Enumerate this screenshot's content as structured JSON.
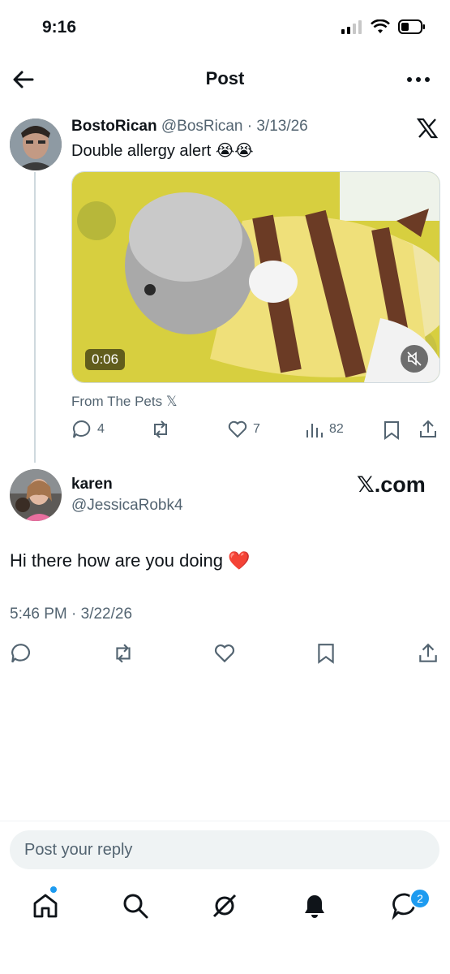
{
  "status": {
    "time": "9:16"
  },
  "header": {
    "title": "Post"
  },
  "quoted_post": {
    "display_name": "BostoRican",
    "handle": "@BosRican",
    "date": "3/13/26",
    "text": "Double allergy alert 😭😭",
    "video_duration": "0:06",
    "source": "From The Pets 𝕏",
    "metrics": {
      "replies": "4",
      "likes": "7",
      "views": "82"
    }
  },
  "reply_post": {
    "display_name": "karen",
    "handle": "@JessicaRobk4",
    "watermark": "𝕏.com",
    "text": "Hi there how are you doing ❤️",
    "timestamp": "5:46 PM · 3/22/26"
  },
  "composer": {
    "placeholder": "Post your reply"
  },
  "bottom_nav": {
    "messages_badge": "2"
  },
  "colors": {
    "accent": "#1d9bf0",
    "muted": "#536471",
    "heart": "#d61f26"
  },
  "icons": [
    "back-arrow-icon",
    "more-icon",
    "x-logo-icon",
    "reply-icon",
    "repost-icon",
    "like-icon",
    "views-icon",
    "bookmark-icon",
    "share-icon",
    "mute-icon",
    "home-icon",
    "search-icon",
    "grok-icon",
    "bell-icon",
    "messages-icon"
  ]
}
